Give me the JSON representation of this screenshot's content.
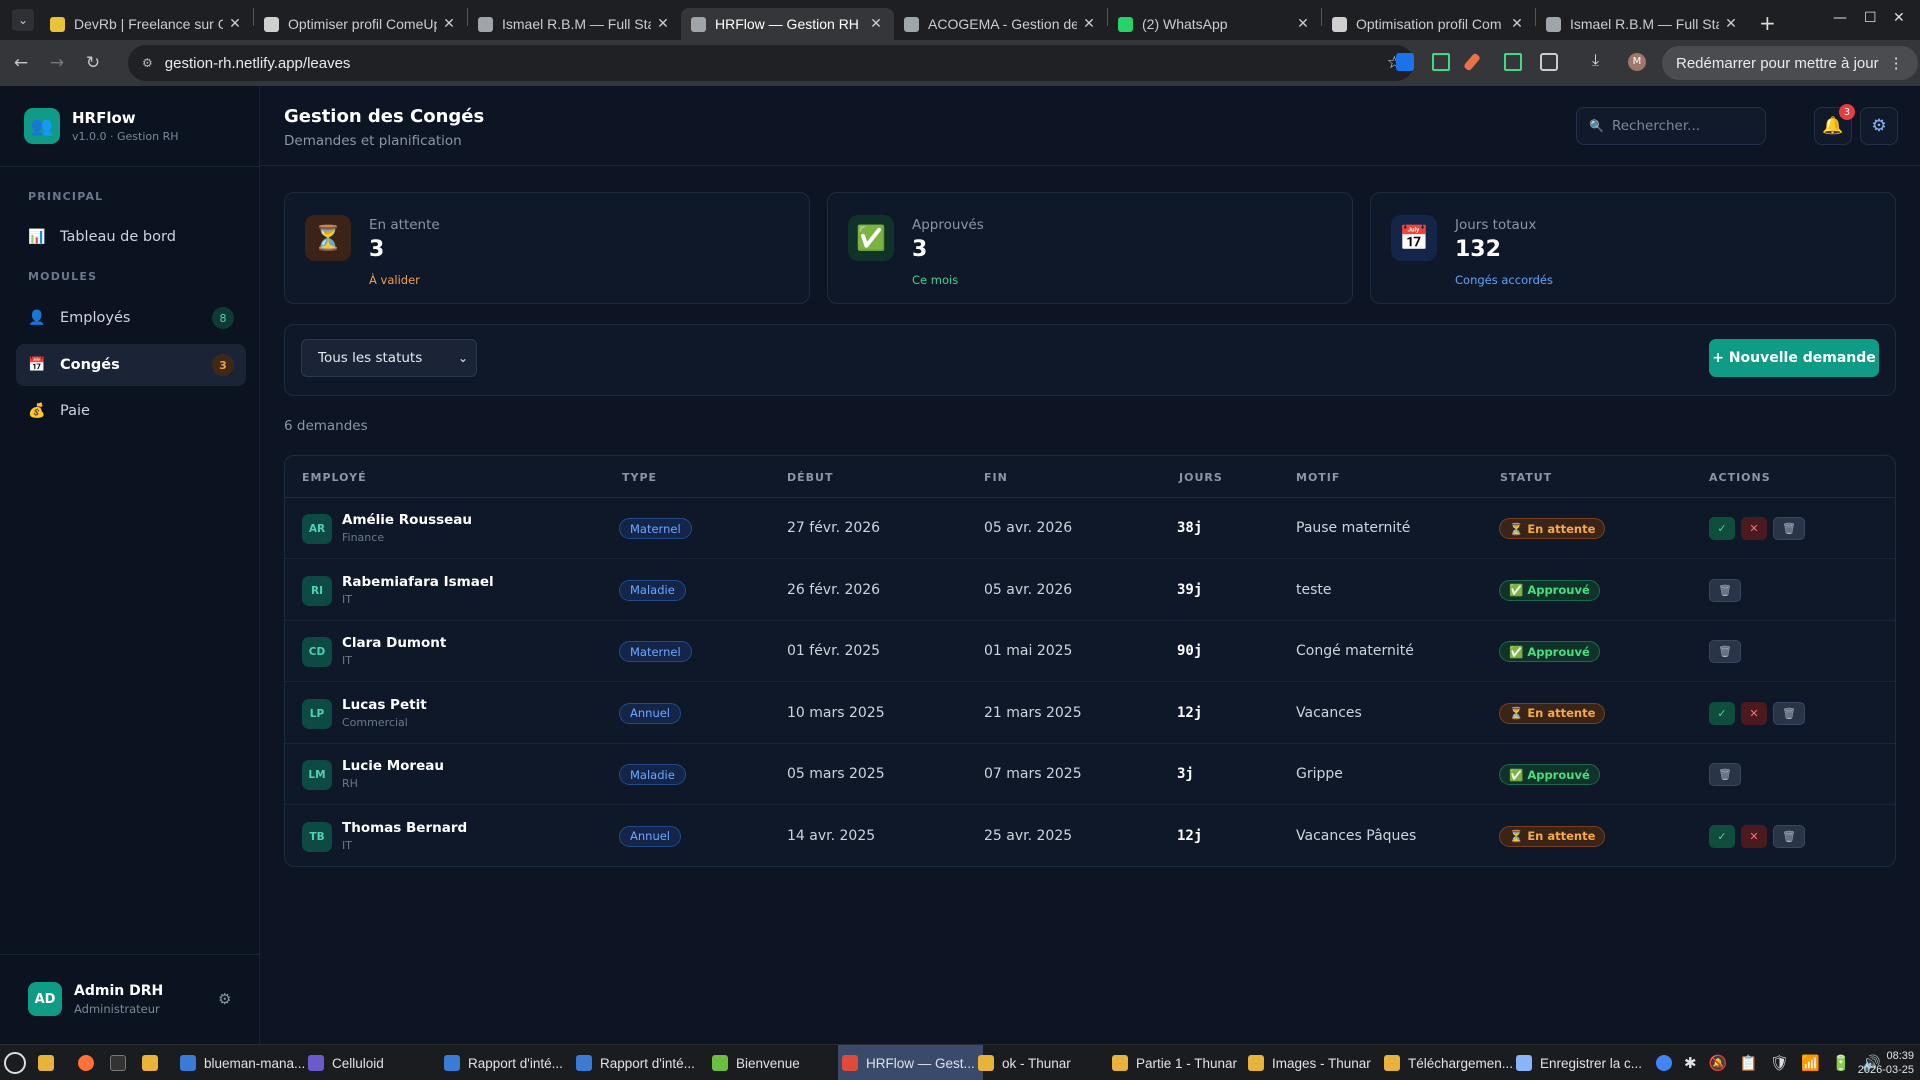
{
  "browser": {
    "tabs": [
      {
        "title": "DevRb | Freelance sur Co",
        "color": "#e8c33a"
      },
      {
        "title": "Optimiser profil ComeUp",
        "color": "#cfcfcf"
      },
      {
        "title": "Ismael R.B.M — Full Stac",
        "color": "#a0a4ab"
      },
      {
        "title": "HRFlow — Gestion RH",
        "color": "#a0a4ab"
      },
      {
        "title": "ACOGEMA - Gestion de l",
        "color": "#a0a4ab"
      },
      {
        "title": "(2) WhatsApp",
        "color": "#25d366"
      },
      {
        "title": "Optimisation profil Com",
        "color": "#cfcfcf"
      },
      {
        "title": "Ismael R.B.M — Full Stac",
        "color": "#a0a4ab"
      }
    ],
    "url": "gestion-rh.netlify.app/leaves",
    "restart_label": "Redémarrer pour mettre à jour"
  },
  "app": {
    "brand": {
      "name": "HRFlow",
      "version": "v1.0.0 · Gestion RH"
    },
    "sections": {
      "principal": "PRINCIPAL",
      "modules": "MODULES"
    },
    "nav": {
      "dashboard": "Tableau de bord",
      "employees": "Employés",
      "employees_count": "8",
      "leaves": "Congés",
      "leaves_count": "3",
      "payroll": "Paie"
    },
    "user": {
      "initials": "AD",
      "name": "Admin DRH",
      "role": "Administrateur"
    },
    "header": {
      "title": "Gestion des Congés",
      "subtitle": "Demandes et planification",
      "search_placeholder": "Rechercher...",
      "notif_count": "3"
    },
    "stats": [
      {
        "label": "En attente",
        "value": "3",
        "sub": "À valider",
        "icon": "⏳",
        "sub_color": "#f0a04b",
        "bg": "#3b2417"
      },
      {
        "label": "Approuvés",
        "value": "3",
        "sub": "Ce mois",
        "icon": "✅",
        "sub_color": "#34d399",
        "bg": "#0f3328"
      },
      {
        "label": "Jours totaux",
        "value": "132",
        "sub": "Congés accordés",
        "icon": "📅",
        "sub_color": "#60a5fa",
        "bg": "#14254a"
      }
    ],
    "filter": {
      "status_select": "Tous les statuts",
      "new_request": "+ Nouvelle demande"
    },
    "count_label": "6 demandes",
    "table": {
      "headers": [
        "EMPLOYÉ",
        "TYPE",
        "DÉBUT",
        "FIN",
        "JOURS",
        "MOTIF",
        "STATUT",
        "ACTIONS"
      ],
      "rows": [
        {
          "initials": "AR",
          "name": "Amélie Rousseau",
          "dept": "Finance",
          "type": "Maternel",
          "start": "27 févr. 2026",
          "end": "05 avr. 2026",
          "days": "38j",
          "reason": "Pause maternité",
          "status": "⏳ En attente",
          "pending": true
        },
        {
          "initials": "RI",
          "name": "Rabemiafara Ismael",
          "dept": "IT",
          "type": "Maladie",
          "start": "26 févr. 2026",
          "end": "05 avr. 2026",
          "days": "39j",
          "reason": "teste",
          "status": "✅ Approuvé",
          "pending": false
        },
        {
          "initials": "CD",
          "name": "Clara Dumont",
          "dept": "IT",
          "type": "Maternel",
          "start": "01 févr. 2025",
          "end": "01 mai 2025",
          "days": "90j",
          "reason": "Congé maternité",
          "status": "✅ Approuvé",
          "pending": false
        },
        {
          "initials": "LP",
          "name": "Lucas Petit",
          "dept": "Commercial",
          "type": "Annuel",
          "start": "10 mars 2025",
          "end": "21 mars 2025",
          "days": "12j",
          "reason": "Vacances",
          "status": "⏳ En attente",
          "pending": true
        },
        {
          "initials": "LM",
          "name": "Lucie Moreau",
          "dept": "RH",
          "type": "Maladie",
          "start": "05 mars 2025",
          "end": "07 mars 2025",
          "days": "3j",
          "reason": "Grippe",
          "status": "✅ Approuvé",
          "pending": false
        },
        {
          "initials": "TB",
          "name": "Thomas Bernard",
          "dept": "IT",
          "type": "Annuel",
          "start": "14 avr. 2025",
          "end": "25 avr. 2025",
          "days": "12j",
          "reason": "Vacances Pâques",
          "status": "⏳ En attente",
          "pending": true
        }
      ]
    }
  },
  "taskbar": {
    "items": [
      {
        "label": "blueman-mana...",
        "color": "#3a7bd5"
      },
      {
        "label": "Celluloid",
        "color": "#6a5acd"
      },
      {
        "label": "Rapport d'inté...",
        "color": "#3a7bd5"
      },
      {
        "label": "Rapport d'inté...",
        "color": "#3a7bd5"
      },
      {
        "label": "Bienvenue",
        "color": "#6abf40"
      },
      {
        "label": "HRFlow — Gest...",
        "color": "#e04a3a"
      },
      {
        "label": "ok - Thunar",
        "color": "#e8b33a"
      },
      {
        "label": "Partie 1 - Thunar",
        "color": "#e8b33a"
      },
      {
        "label": "Images - Thunar",
        "color": "#e8b33a"
      },
      {
        "label": "Téléchargemen...",
        "color": "#e8b33a"
      },
      {
        "label": "Enregistrer la c...",
        "color": "#8ab4f8"
      }
    ],
    "time": "08:39",
    "date": "2026-03-25"
  }
}
